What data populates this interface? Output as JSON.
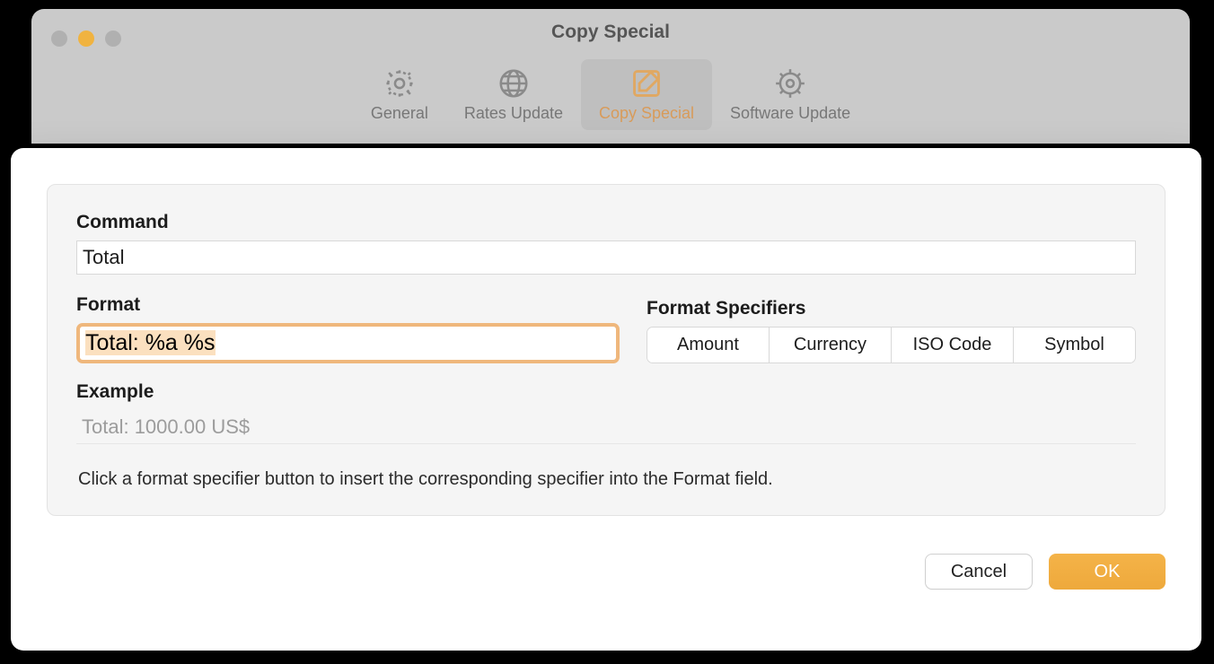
{
  "parent_window": {
    "title": "Copy Special",
    "tabs": [
      {
        "label": "General",
        "icon": "gear"
      },
      {
        "label": "Rates Update",
        "icon": "globe"
      },
      {
        "label": "Copy Special",
        "icon": "compose",
        "active": true
      },
      {
        "label": "Software Update",
        "icon": "gear-outline"
      }
    ]
  },
  "sheet": {
    "command_label": "Command",
    "command_value": "Total",
    "format_label": "Format",
    "format_value": "Total: %a %s",
    "specifiers_label": "Format Specifiers",
    "specifiers": [
      "Amount",
      "Currency",
      "ISO Code",
      "Symbol"
    ],
    "example_label": "Example",
    "example_value": "Total: 1000.00 US$",
    "hint": "Click a format specifier button to insert the corresponding specifier into the Format field.",
    "cancel_label": "Cancel",
    "ok_label": "OK"
  }
}
